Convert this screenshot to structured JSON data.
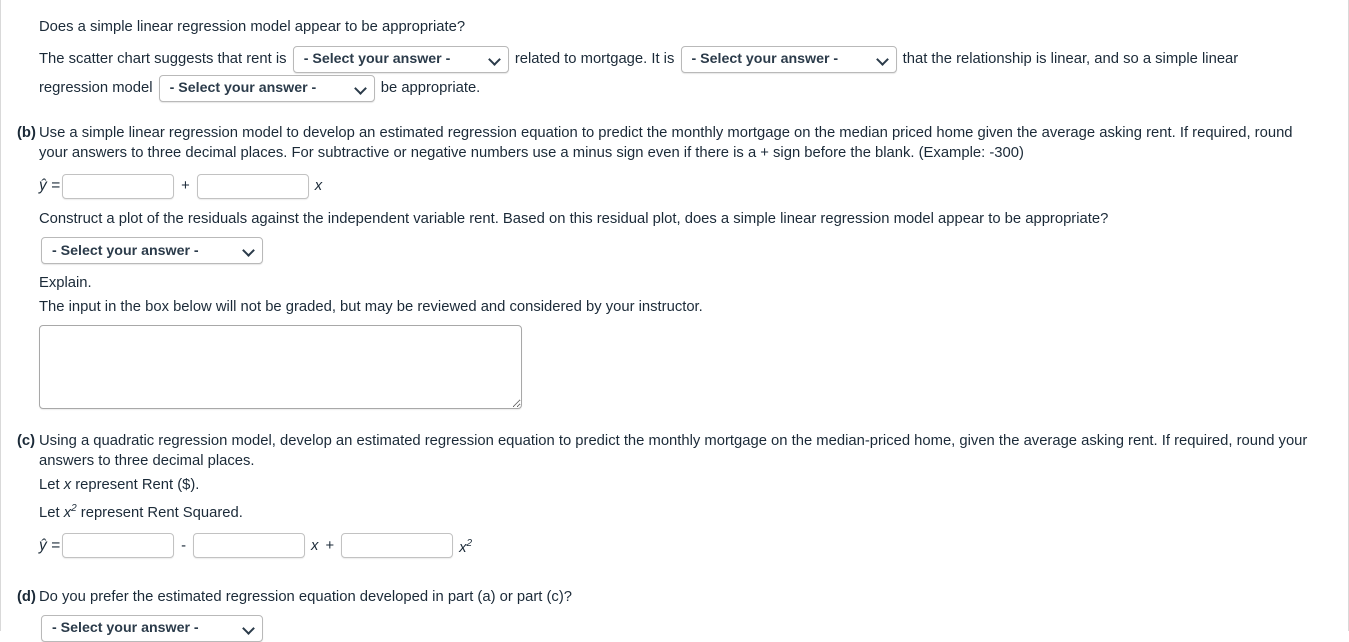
{
  "part_a_tail": {
    "question": "Does a simple linear regression model appear to be appropriate?",
    "sentence_1a": "The scatter chart suggests that rent is",
    "select_1": "- Select your answer -",
    "sentence_1b": "related to mortgage. It is",
    "select_2": "- Select your answer -",
    "sentence_1c": "that the relationship is linear, and so a simple linear",
    "sentence_2a": "regression model",
    "select_3": "- Select your answer -",
    "sentence_2b": "be appropriate."
  },
  "part_b": {
    "label": "(b)",
    "prompt": "Use a simple linear regression model to develop an estimated regression equation to predict the monthly mortgage on the median priced home given the average asking rent. If required, round your answers to three decimal places. For subtractive or negative numbers use a minus sign even if there is a + sign before the blank. (Example: -300)",
    "equation": {
      "yhat": "ŷ =",
      "input_intercept_value": "",
      "operator": "+",
      "input_slope_value": "",
      "variable": "x"
    },
    "residual_prompt": "Construct a plot of the residuals against the independent variable rent. Based on this residual plot, does a simple linear regression model appear to be appropriate?",
    "select_residual": "- Select your answer -",
    "explain_label": "Explain.",
    "explain_note": "The input in the box below will not be graded, but may be reviewed and considered by your instructor.",
    "explain_value": "",
    "explain_placeholder": ""
  },
  "part_c": {
    "label": "(c)",
    "prompt": "Using a quadratic regression model, develop an estimated regression equation to predict the monthly mortgage on the median-priced home, given the average asking rent. If required, round your answers to three decimal places.",
    "let_x": "Let x represent Rent ($).",
    "let_x_prefix": "Let",
    "let_x_var": "x",
    "let_x_suffix": "represent Rent ($).",
    "let_x2_prefix": "Let",
    "let_x2_var": "x",
    "let_x2_exp": "2",
    "let_x2_suffix": "represent Rent Squared.",
    "equation": {
      "yhat": "ŷ =",
      "input_a_value": "",
      "operator_1": "-",
      "input_b_value": "",
      "variable_1": "x",
      "operator_2": "+",
      "input_c_value": "",
      "variable_2": "x",
      "variable_2_exp": "2"
    }
  },
  "part_d": {
    "label": "(d)",
    "prompt": "Do you prefer the estimated regression equation developed in part (a) or part (c)?",
    "select_preference": "- Select your answer -"
  },
  "colors": {
    "text": "#1b2a38",
    "border": "#c2c2c2",
    "page_border": "#d9d9d9"
  }
}
